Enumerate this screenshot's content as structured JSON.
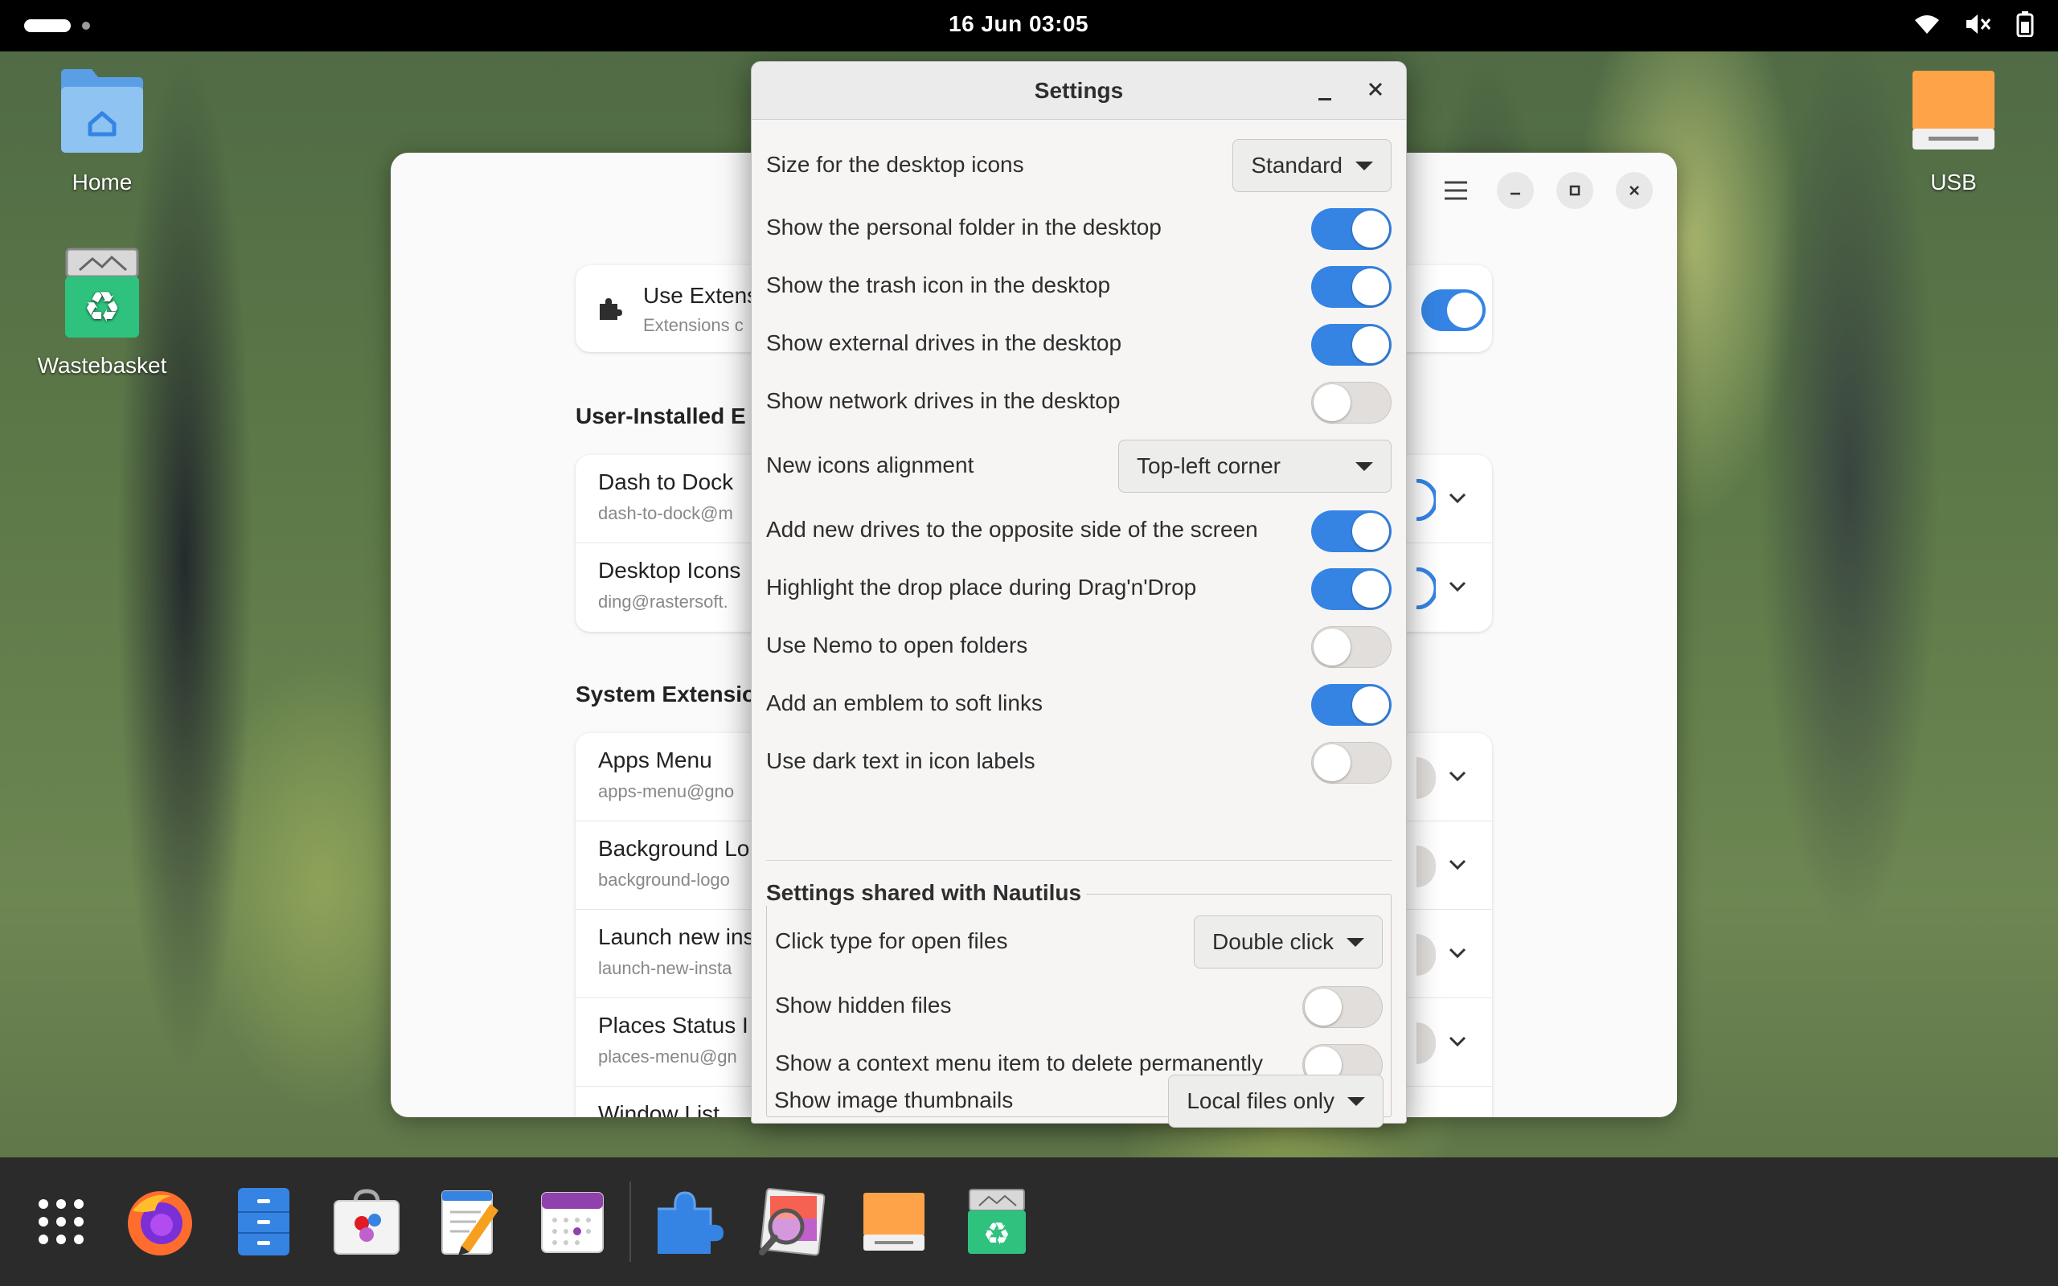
{
  "topbar": {
    "clock": "16 Jun  03:05",
    "tray_icons": [
      "wifi-icon",
      "volume-muted-icon",
      "battery-icon"
    ]
  },
  "desktop": {
    "icons": [
      {
        "name": "Home",
        "icon": "home-folder-icon"
      },
      {
        "name": "Wastebasket",
        "icon": "wastebasket-icon"
      },
      {
        "name": "USB",
        "icon": "usb-drive-icon"
      }
    ]
  },
  "extensions_window": {
    "use_extensions": {
      "title": "Use Extens",
      "subtitle": "Extensions c",
      "enabled": true
    },
    "user_installed_title": "User-Installed E",
    "user_installed": [
      {
        "title": "Dash to Dock",
        "subtitle": "dash-to-dock@m",
        "enabled": true
      },
      {
        "title": "Desktop Icons",
        "subtitle": "ding@rastersoft.",
        "enabled": true
      }
    ],
    "system_title": "System Extensio",
    "system": [
      {
        "title": "Apps Menu",
        "subtitle": "apps-menu@gno",
        "enabled": false
      },
      {
        "title": "Background Lo",
        "subtitle": "background-logo",
        "enabled": false
      },
      {
        "title": "Launch new ins",
        "subtitle": "launch-new-insta",
        "enabled": false
      },
      {
        "title": "Places Status I",
        "subtitle": "places-menu@gn",
        "enabled": false
      },
      {
        "title": "Window List",
        "subtitle": "",
        "enabled": false
      }
    ]
  },
  "settings": {
    "title": "Settings",
    "rows": [
      {
        "label": "Size for the desktop icons",
        "type": "dropdown",
        "value": "Standard"
      },
      {
        "label": "Show the personal folder in the desktop",
        "type": "toggle",
        "on": true
      },
      {
        "label": "Show the trash icon in the desktop",
        "type": "toggle",
        "on": true
      },
      {
        "label": "Show external drives in the desktop",
        "type": "toggle",
        "on": true
      },
      {
        "label": "Show network drives in the desktop",
        "type": "toggle",
        "on": false
      },
      {
        "label": "New icons alignment",
        "type": "dropdown",
        "value": "Top-left corner"
      },
      {
        "label": "Add new drives to the opposite side of the screen",
        "type": "toggle",
        "on": true
      },
      {
        "label": "Highlight the drop place during Drag'n'Drop",
        "type": "toggle",
        "on": true
      },
      {
        "label": "Use Nemo to open folders",
        "type": "toggle",
        "on": false
      },
      {
        "label": "Add an emblem to soft links",
        "type": "toggle",
        "on": true
      },
      {
        "label": "Use dark text in icon labels",
        "type": "toggle",
        "on": false
      }
    ],
    "nautilus_title": "Settings shared with Nautilus",
    "nautilus_rows": [
      {
        "label": "Click type for open files",
        "type": "dropdown",
        "value": "Double click"
      },
      {
        "label": "Show hidden files",
        "type": "toggle",
        "on": false
      },
      {
        "label": "Show a context menu item to delete permanently",
        "type": "toggle",
        "on": false
      },
      {
        "label": "Show image thumbnails",
        "type": "dropdown",
        "value": "Local files only"
      }
    ]
  },
  "dock": {
    "items": [
      "app-grid-icon",
      "firefox-icon",
      "files-icon",
      "software-icon",
      "text-editor-icon",
      "calendar-icon",
      "extensions-icon",
      "image-viewer-icon",
      "usb-drive-icon",
      "wastebasket-icon"
    ]
  },
  "colors": {
    "accent": "#3584e4",
    "toggle_off": "#e1dedb",
    "dialog_bg": "#f6f5f4"
  }
}
